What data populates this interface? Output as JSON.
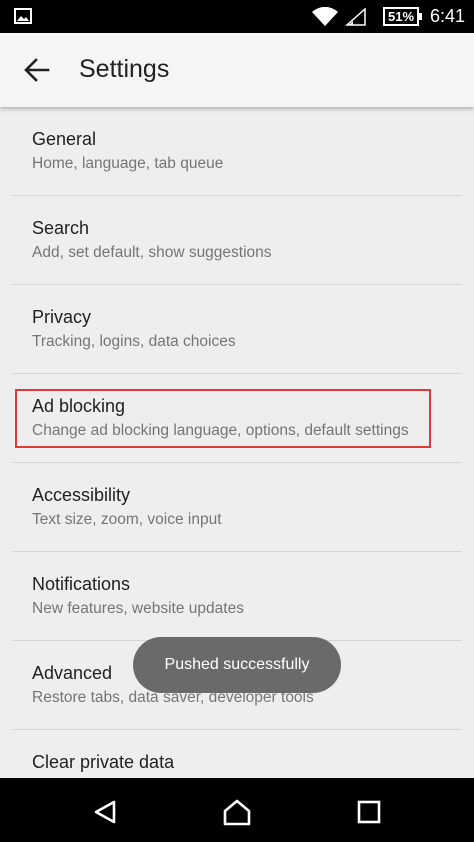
{
  "status_bar": {
    "battery": "51%",
    "time": "6:41",
    "icons": [
      "image-icon",
      "wifi-icon",
      "signal-icon",
      "battery-icon"
    ]
  },
  "toolbar": {
    "back_icon": "arrow-left-icon",
    "title": "Settings"
  },
  "settings": {
    "items": [
      {
        "title": "General",
        "subtitle": "Home, language, tab queue"
      },
      {
        "title": "Search",
        "subtitle": "Add, set default, show suggestions"
      },
      {
        "title": "Privacy",
        "subtitle": "Tracking, logins, data choices"
      },
      {
        "title": "Ad blocking",
        "subtitle": "Change ad blocking language, options, default settings"
      },
      {
        "title": "Accessibility",
        "subtitle": "Text size, zoom, voice input"
      },
      {
        "title": "Notifications",
        "subtitle": "New features, website updates"
      },
      {
        "title": "Advanced",
        "subtitle": "Restore tabs, data saver, developer tools"
      },
      {
        "title": "Clear private data",
        "subtitle": ""
      }
    ]
  },
  "highlight_color": "#e0393a",
  "toast": {
    "text": "Pushed successfully"
  },
  "nav_bar": {
    "icons": [
      "back-triangle-icon",
      "home-icon",
      "recents-square-icon"
    ]
  }
}
